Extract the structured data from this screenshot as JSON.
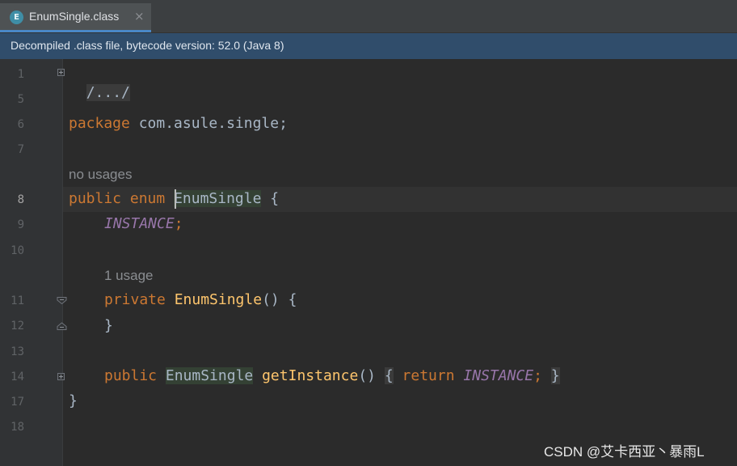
{
  "tab": {
    "icon_letter": "E",
    "title": "EnumSingle.class",
    "close": "×",
    "icon": "enum-file-icon"
  },
  "banner": {
    "text": "Decompiled .class file, bytecode version: 52.0 (Java 8)"
  },
  "line_numbers": [
    "1",
    "5",
    "6",
    "7",
    "8",
    "9",
    "10",
    "11",
    "12",
    "13",
    "14",
    "17",
    "18"
  ],
  "code": {
    "l1": "/.../",
    "l6_kw": "package",
    "l6_rest": " com.asule.single;",
    "hint_no_usages": "no usages",
    "l8_kw1": "public",
    "l8_kw2": "enum",
    "l8_cls": "EnumSingle",
    "l8_brace": " {",
    "l9_const": "INSTANCE",
    "l9_semi": ";",
    "hint_1_usage": "1 usage",
    "l11_kw": "private",
    "l11_fn": "EnumSingle",
    "l11_rest": "() {",
    "l12": "}",
    "l14_kw": "public",
    "l14_cls": "EnumSingle",
    "l14_fn": "getInstance",
    "l14_parens": "()",
    "l14_open": "{",
    "l14_return": "return",
    "l14_const": "INSTANCE",
    "l14_semi": ";",
    "l14_close": "}",
    "l17": "}"
  },
  "watermark": "CSDN @艾卡西亚丶暴雨L"
}
